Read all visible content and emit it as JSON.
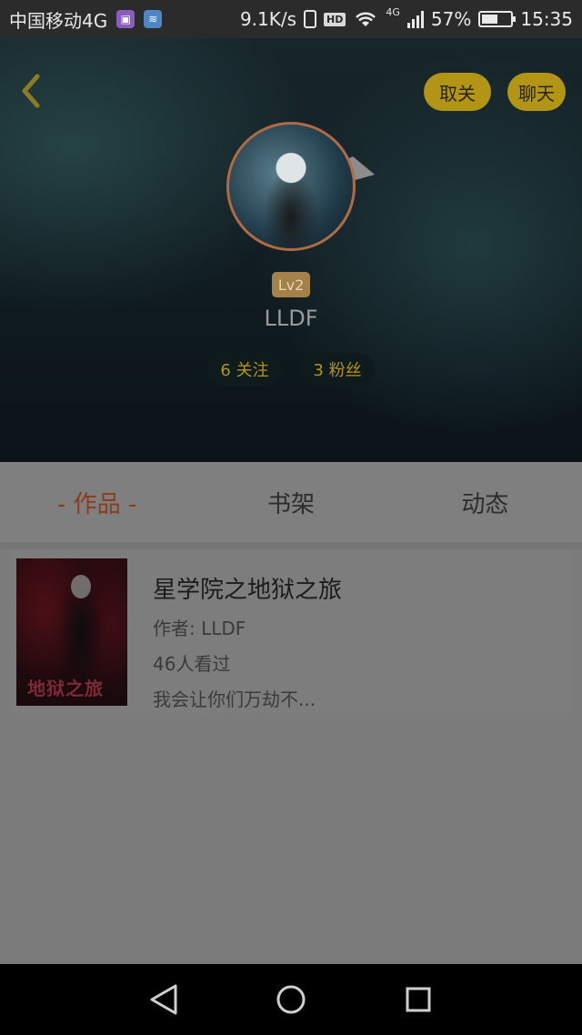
{
  "status_bar": {
    "carrier": "中国移动4G",
    "speed": "9.1K/s",
    "hd": "HD",
    "network": "4G",
    "battery": "57%",
    "battery_level": 0.57,
    "time": "15:35"
  },
  "header": {
    "unfollow_label": "取关",
    "chat_label": "聊天",
    "level": "Lv2",
    "username": "LLDF",
    "following": "6 关注",
    "fans": "3 粉丝"
  },
  "tabs": [
    {
      "label": "- 作品 -",
      "active": true
    },
    {
      "label": "书架",
      "active": false
    },
    {
      "label": "动态",
      "active": false
    }
  ],
  "books": [
    {
      "cover_text": "地狱之旅",
      "title": "星学院之地狱之旅",
      "author": "作者: LLDF",
      "views": "46人看过",
      "summary": "我会让你们万劫不..."
    }
  ],
  "colors": {
    "accent_gold": "#b39515",
    "active_tab": "#8a3d1c",
    "overlay_gray": "#7b7b7b"
  },
  "icons": {
    "back": "chevron-left-icon",
    "nav_back": "triangle-back-icon",
    "nav_home": "circle-home-icon",
    "nav_recent": "square-recent-icon"
  }
}
